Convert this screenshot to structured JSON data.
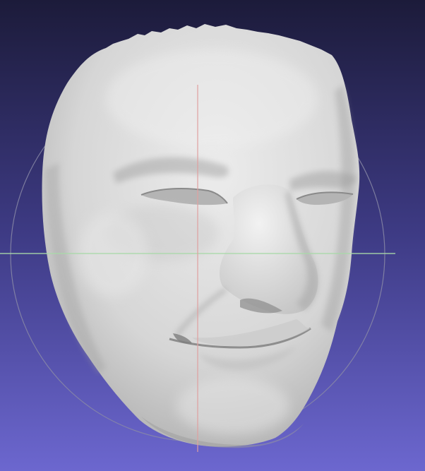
{
  "viewport": {
    "background_top": "#1c1b3a",
    "background_bottom": "#6c67cf",
    "mesh_color": "#d8d8d8"
  },
  "trackball": {
    "ring_color": "#8a8aa6",
    "horizontal_axis_color": "#a9d9a9",
    "vertical_axis_color": "#e0a0a0"
  }
}
